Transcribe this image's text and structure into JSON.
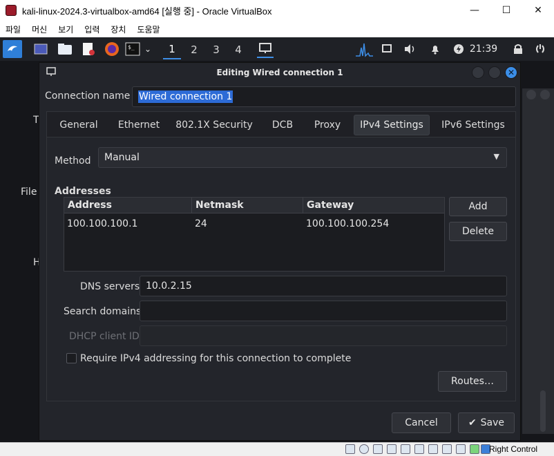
{
  "host": {
    "window_title": "kali-linux-2024.3-virtualbox-amd64 [실행 중] - Oracle VirtualBox",
    "controls": {
      "minimize": "—",
      "maximize": "☐",
      "close": "✕"
    },
    "menu": [
      "파일",
      "머신",
      "보기",
      "입력",
      "장치",
      "도움말"
    ],
    "status_right": "Right Control"
  },
  "panel": {
    "workspaces": [
      "1",
      "2",
      "3",
      "4"
    ],
    "active_workspace": "1",
    "clock": "21:39"
  },
  "dialog": {
    "title": "Editing Wired connection 1",
    "connection_name_label": "Connection name",
    "connection_name_value": "Wired connection 1",
    "tabs": [
      "General",
      "Ethernet",
      "802.1X Security",
      "DCB",
      "Proxy",
      "IPv4 Settings",
      "IPv6 Settings"
    ],
    "active_tab": "IPv4 Settings",
    "method_label": "Method",
    "method_value": "Manual",
    "addresses_label": "Addresses",
    "table": {
      "headers": [
        "Address",
        "Netmask",
        "Gateway"
      ],
      "rows": [
        [
          "100.100.100.1",
          "24",
          "100.100.100.254"
        ]
      ]
    },
    "add_button": "Add",
    "delete_button": "Delete",
    "dns_label": "DNS servers",
    "dns_value": "10.0.2.15",
    "search_label": "Search domains",
    "search_value": "",
    "dhcp_label": "DHCP client ID",
    "dhcp_value": "",
    "require_label": "Require IPv4 addressing for this connection to complete",
    "require_checked": false,
    "routes_button": "Routes…",
    "cancel_button": "Cancel",
    "save_button": "Save"
  },
  "desktop_icons": [
    "T",
    "File",
    "H"
  ],
  "icons": {
    "vbox": "virtualbox-icon",
    "kali": "kali-dragon-icon",
    "check": "checkmark-icon"
  }
}
